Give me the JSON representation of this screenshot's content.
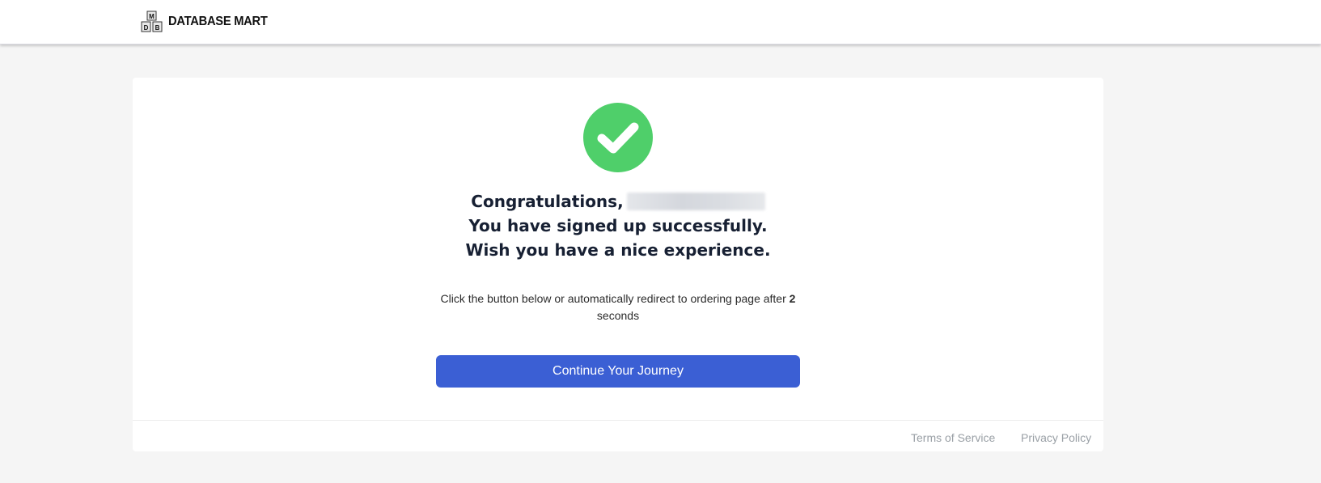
{
  "header": {
    "logo_text": "DATABASE MART",
    "logo_mark_letters": [
      "M",
      "D",
      "B"
    ]
  },
  "success": {
    "icon": "check-circle-icon",
    "icon_color": "#4fcf6a",
    "greeting": "Congratulations,",
    "line2": "You have signed up successfully.",
    "line3": "Wish you have a nice experience."
  },
  "redirect": {
    "text_before": "Click the button below or automatically redirect to ordering page after ",
    "seconds": "2",
    "text_after": "seconds"
  },
  "cta": {
    "label": "Continue Your Journey",
    "color": "#3b5fd4"
  },
  "footer": {
    "terms_label": "Terms of Service",
    "privacy_label": "Privacy Policy"
  }
}
